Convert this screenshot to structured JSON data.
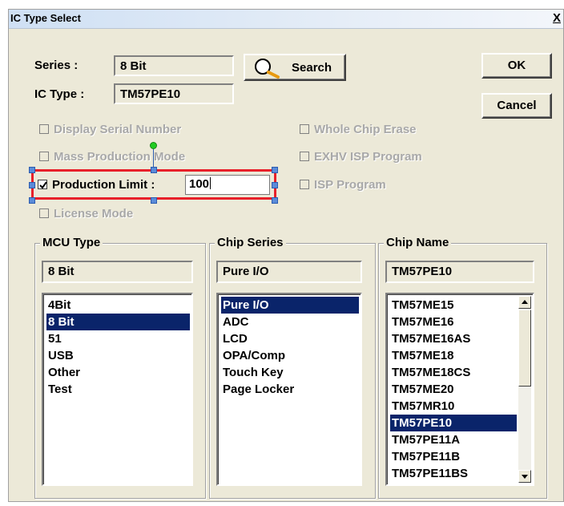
{
  "window": {
    "title": "IC Type Select",
    "close_glyph": "X"
  },
  "series": {
    "label": "Series :",
    "value": "8 Bit"
  },
  "ic_type": {
    "label": "IC Type :",
    "value": "TM57PE10"
  },
  "buttons": {
    "search": "Search",
    "ok": "OK",
    "cancel": "Cancel"
  },
  "options": {
    "display_serial_number": {
      "label": "Display Serial Number",
      "checked": false,
      "enabled": false
    },
    "whole_chip_erase": {
      "label": "Whole Chip Erase",
      "checked": false,
      "enabled": false
    },
    "mass_production_mode": {
      "label": "Mass Production Mode",
      "checked": false,
      "enabled": false
    },
    "exhv_isp_program": {
      "label": "EXHV ISP Program",
      "checked": false,
      "enabled": false
    },
    "production_limit": {
      "label": "Production Limit :",
      "checked": true,
      "enabled": true,
      "value": "100"
    },
    "isp_program": {
      "label": "ISP Program",
      "checked": false,
      "enabled": false
    },
    "license_mode": {
      "label": "License Mode",
      "checked": false,
      "enabled": false
    }
  },
  "mcu_type": {
    "title": "MCU Type",
    "current": "8 Bit",
    "items": [
      "4Bit",
      "8 Bit",
      "51",
      "USB",
      "Other",
      "Test"
    ],
    "selected_index": 1
  },
  "chip_series": {
    "title": "Chip Series",
    "current": "Pure I/O",
    "items": [
      "Pure I/O",
      "ADC",
      "LCD",
      "OPA/Comp",
      "Touch Key",
      "Page Locker"
    ],
    "selected_index": 0
  },
  "chip_name": {
    "title": "Chip Name",
    "current": "TM57PE10",
    "items": [
      "TM57ME15",
      "TM57ME16",
      "TM57ME16AS",
      "TM57ME18",
      "TM57ME18CS",
      "TM57ME20",
      "TM57MR10",
      "TM57PE10",
      "TM57PE11A",
      "TM57PE11B",
      "TM57PE11BS"
    ],
    "selected_index": 7
  },
  "colors": {
    "dialog_bg": "#ece9d8",
    "selection_bg": "#0a246a",
    "selection_fg": "#ffffff",
    "highlight_frame": "#e8202a",
    "handle": "#5b8bd9",
    "rotate_handle": "#22cc22"
  }
}
